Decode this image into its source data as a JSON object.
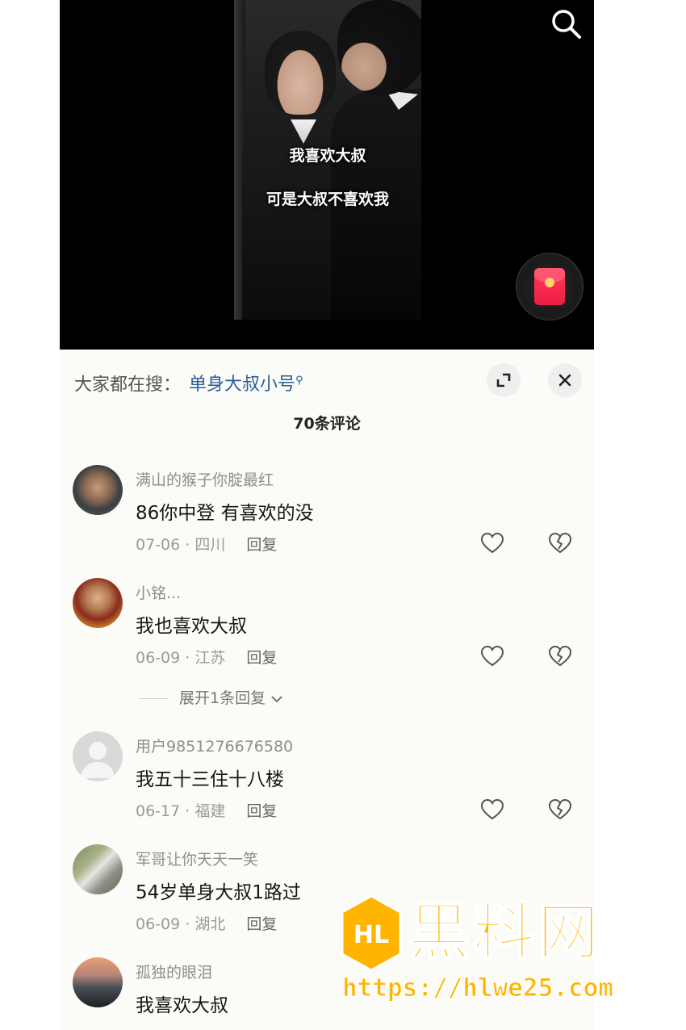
{
  "video": {
    "caption_line1": "我喜欢大叔",
    "caption_line2": "可是大叔不喜欢我"
  },
  "suggest": {
    "label": "大家都在搜：",
    "term": "单身大叔小号",
    "expand_icon": "expand-icon",
    "close_icon": "close-icon"
  },
  "comments_header": {
    "count_label": "70条评论"
  },
  "comments": [
    {
      "user": "满山的猴子你腚最红",
      "text": "86你中登  有喜欢的没",
      "date": "07-06",
      "region": "四川",
      "reply": "回复"
    },
    {
      "user": "小铭...",
      "text": "我也喜欢大叔",
      "date": "06-09",
      "region": "江苏",
      "reply": "回复",
      "expand": "展开1条回复"
    },
    {
      "user": "用户9851276676580",
      "text": "我五十三住十八楼",
      "date": "06-17",
      "region": "福建",
      "reply": "回复"
    },
    {
      "user": "军哥让你天天一笑",
      "text": "54岁单身大叔1路过",
      "date": "06-09",
      "region": "湖北",
      "reply": "回复"
    },
    {
      "user": "孤独的眼泪",
      "text": "我喜欢大叔"
    }
  ],
  "watermark": {
    "title": "黑料网",
    "url": "https://hlwe25.com",
    "logo_text": "HL"
  },
  "colors": {
    "accent_link": "#2c5b9a",
    "watermark": "#ffb400",
    "red_packet": "#ee1c44"
  }
}
